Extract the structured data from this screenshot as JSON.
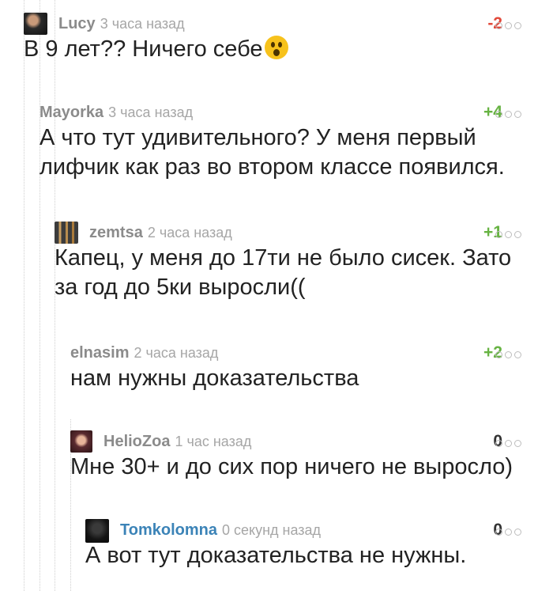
{
  "comments": [
    {
      "author": "Lucy",
      "time": "3 часа назад",
      "rating": "-2",
      "rating_type": "neg",
      "text": "В 9 лет?? Ничего себе",
      "emoji": "astonished-face-emoji",
      "avatar": "dark-photo"
    },
    {
      "author": "Mayorka",
      "time": "3 часа назад",
      "rating": "+4",
      "rating_type": "pos",
      "text": "А что тут удивительного? У меня первый\nлифчик как раз во втором классе появился.",
      "avatar": "none"
    },
    {
      "author": "zemtsa",
      "time": "2 часа назад",
      "rating": "+1",
      "rating_type": "pos",
      "text": "Капец, у меня до 17ти не было сисек. Зато\nза год до 5ки выросли((",
      "avatar": "spoons-photo"
    },
    {
      "author": "elnasim",
      "time": "2 часа назад",
      "rating": "+2",
      "rating_type": "pos",
      "text": "нам нужны доказательства",
      "avatar": "none"
    },
    {
      "author": "HelioZoa",
      "time": "1 час назад",
      "rating": "0",
      "rating_type": "zero",
      "text": "Мне 30+ и до сих пор ничего не выросло)",
      "avatar": "portrait-photo"
    },
    {
      "author": "Tomkolomna",
      "time": "0 секунд назад",
      "rating": "0",
      "rating_type": "zero",
      "text": "А вот тут доказательства не нужны.",
      "avatar": "dark-square",
      "author_is_current_user": true
    }
  ],
  "colors": {
    "negative": "#e24a3b",
    "positive": "#67b343",
    "current_user": "#3b83b7",
    "muted": "#8b8b8b"
  },
  "icons": {
    "menu": "three-dots-menu-icon"
  }
}
